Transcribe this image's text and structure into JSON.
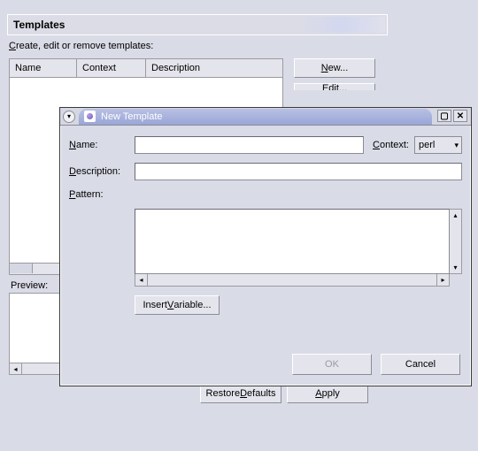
{
  "prefs": {
    "section_title": "Templates",
    "caption_pre": "C",
    "caption_rest": "reate, edit or remove templates:",
    "columns": {
      "name": "Name",
      "context": "Context",
      "description": "Description"
    },
    "buttons": {
      "new_pre": "N",
      "new_rest": "ew...",
      "edit": "Edit...",
      "preview_label": "Preview:",
      "restore_pre": "Restore ",
      "restore_und": "D",
      "restore_rest": "efaults",
      "apply_und": "A",
      "apply_rest": "pply"
    }
  },
  "dialog": {
    "title": "New Template",
    "labels": {
      "name_und": "N",
      "name_rest": "ame:",
      "desc_und": "D",
      "desc_rest": "escription:",
      "pattern_und": "P",
      "pattern_rest": "attern:",
      "context_und": "C",
      "context_rest": "ontext:"
    },
    "fields": {
      "name_value": "",
      "description_value": "",
      "pattern_value": "",
      "context_selected": "perl"
    },
    "buttons": {
      "insert_pre": "Insert ",
      "insert_und": "V",
      "insert_rest": "ariable...",
      "ok": "OK",
      "cancel": "Cancel"
    }
  }
}
